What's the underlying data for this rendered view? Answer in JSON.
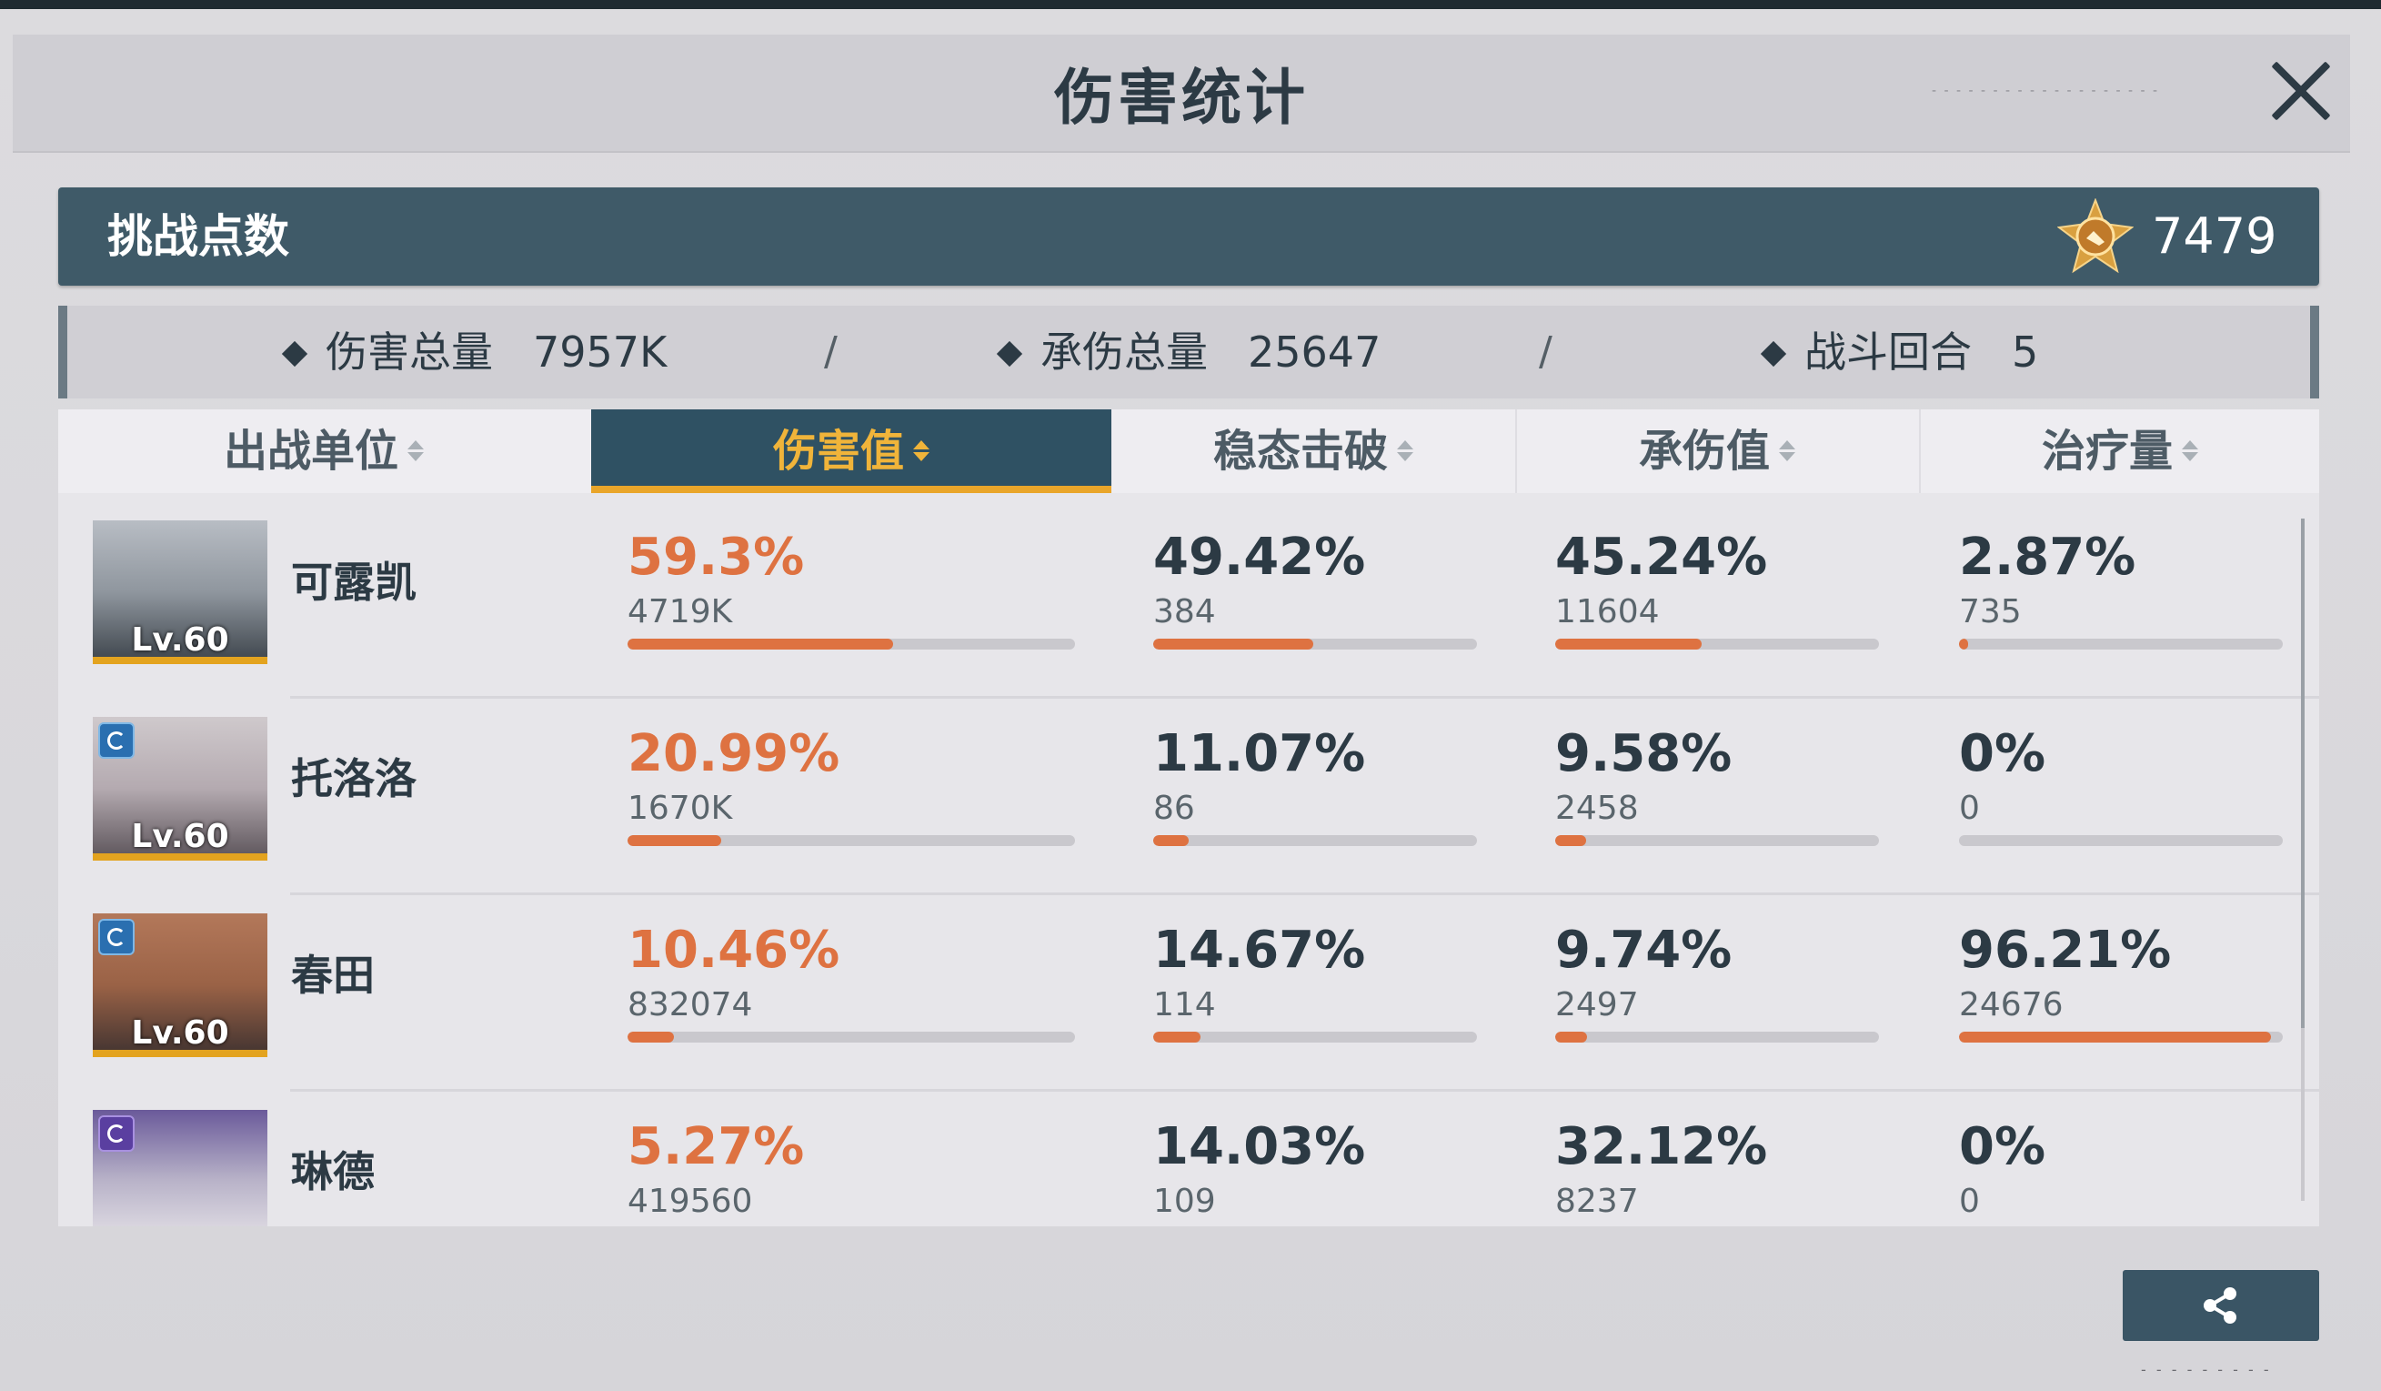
{
  "window": {
    "title": "伤害统计"
  },
  "points": {
    "label": "挑战点数",
    "value": "7479"
  },
  "summary": {
    "damage_total_label": "伤害总量",
    "damage_total_value": "7957K",
    "taken_total_label": "承伤总量",
    "taken_total_value": "25647",
    "rounds_label": "战斗回合",
    "rounds_value": "5",
    "separator": "/"
  },
  "table": {
    "columns": [
      "出战单位",
      "伤害值",
      "稳态击破",
      "承伤值",
      "治疗量"
    ],
    "active_sort_column": "伤害值",
    "rows": [
      {
        "name": "可露凯",
        "level": "Lv.60",
        "damage": {
          "pct": "59.3%",
          "raw": "4719K",
          "fraction": 0.593
        },
        "break": {
          "pct": "49.42%",
          "raw": "384",
          "fraction": 0.4942
        },
        "taken": {
          "pct": "45.24%",
          "raw": "11604",
          "fraction": 0.4524
        },
        "heal": {
          "pct": "2.87%",
          "raw": "735",
          "fraction": 0.0287
        }
      },
      {
        "name": "托洛洛",
        "level": "Lv.60",
        "damage": {
          "pct": "20.99%",
          "raw": "1670K",
          "fraction": 0.2099
        },
        "break": {
          "pct": "11.07%",
          "raw": "86",
          "fraction": 0.1107
        },
        "taken": {
          "pct": "9.58%",
          "raw": "2458",
          "fraction": 0.0958
        },
        "heal": {
          "pct": "0%",
          "raw": "0",
          "fraction": 0
        }
      },
      {
        "name": "春田",
        "level": "Lv.60",
        "damage": {
          "pct": "10.46%",
          "raw": "832074",
          "fraction": 0.1046
        },
        "break": {
          "pct": "14.67%",
          "raw": "114",
          "fraction": 0.1467
        },
        "taken": {
          "pct": "9.74%",
          "raw": "2497",
          "fraction": 0.0974
        },
        "heal": {
          "pct": "96.21%",
          "raw": "24676",
          "fraction": 0.9621
        }
      },
      {
        "name": "琳德",
        "level": "",
        "damage": {
          "pct": "5.27%",
          "raw": "419560",
          "fraction": 0.0527
        },
        "break": {
          "pct": "14.03%",
          "raw": "109",
          "fraction": 0.1403
        },
        "taken": {
          "pct": "32.12%",
          "raw": "8237",
          "fraction": 0.3212
        },
        "heal": {
          "pct": "0%",
          "raw": "0",
          "fraction": 0
        }
      }
    ]
  },
  "icons": {
    "close": "close-icon",
    "medal": "medal-icon",
    "share": "share-icon",
    "sort": "sort-icon"
  },
  "colors": {
    "accent_orange": "#de7241",
    "active_tab": "#2f5163",
    "active_tab_text": "#f0b43a",
    "header_bar": "#3f5a68"
  }
}
